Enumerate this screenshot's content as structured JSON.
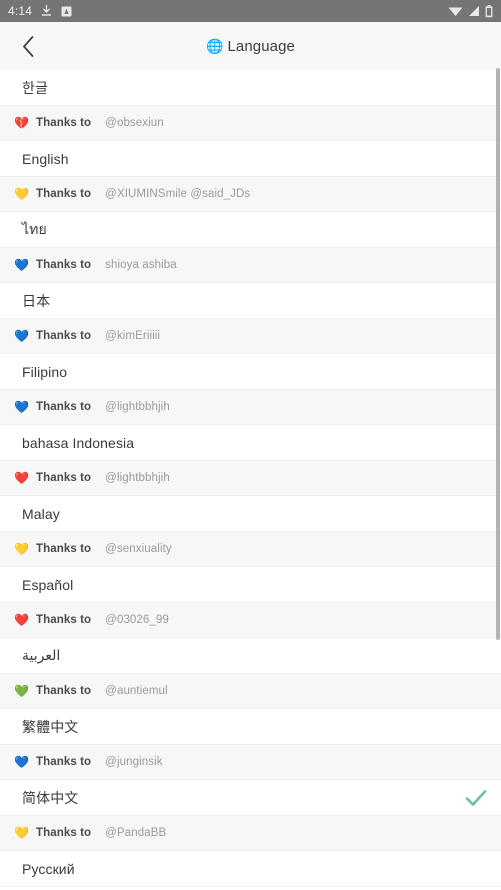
{
  "statusbar": {
    "time": "4:14",
    "left_icons": [
      "download-icon",
      "app-notification-icon"
    ],
    "right_icons": [
      "wifi-icon",
      "cell-signal-icon",
      "battery-icon"
    ],
    "background_color": "#757575"
  },
  "header": {
    "back_icon": "chevron-left-icon",
    "globe_icon": "🌐",
    "title": "Language",
    "background_color": "#f7f7f7"
  },
  "list": {
    "thanks_label": "Thanks to",
    "selected_language": "简体中文",
    "check_icon_color": "#6fbf9a",
    "rows": [
      {
        "language": "한글",
        "heart": "💔",
        "credit": "@obsexiun",
        "selected": false
      },
      {
        "language": "English",
        "heart": "💛",
        "credit": "@XIUMINSmile  @said_JDs",
        "selected": false
      },
      {
        "language": "ไทย",
        "heart": "💙",
        "credit": "shioya ashiba",
        "selected": false
      },
      {
        "language": "日本",
        "heart": "💙",
        "credit": "@kimEriiiii",
        "selected": false
      },
      {
        "language": "Filipino",
        "heart": "💙",
        "credit": "@lightbbhjih",
        "selected": false
      },
      {
        "language": "bahasa Indonesia",
        "heart": "❤️",
        "credit": "@lightbbhjih",
        "selected": false
      },
      {
        "language": "Malay",
        "heart": "💛",
        "credit": "@senxiuality",
        "selected": false
      },
      {
        "language": "Español",
        "heart": "❤️",
        "credit": "@03026_99",
        "selected": false
      },
      {
        "language": "العربية",
        "heart": "💚",
        "credit": "@auntiemul",
        "selected": false
      },
      {
        "language": "繁體中文",
        "heart": "💙",
        "credit": "@junginsik",
        "selected": false
      },
      {
        "language": "简体中文",
        "heart": "💛",
        "credit": "@PandaBB",
        "selected": true
      },
      {
        "language": "Русский",
        "heart": null,
        "credit": null,
        "selected": false
      }
    ]
  }
}
